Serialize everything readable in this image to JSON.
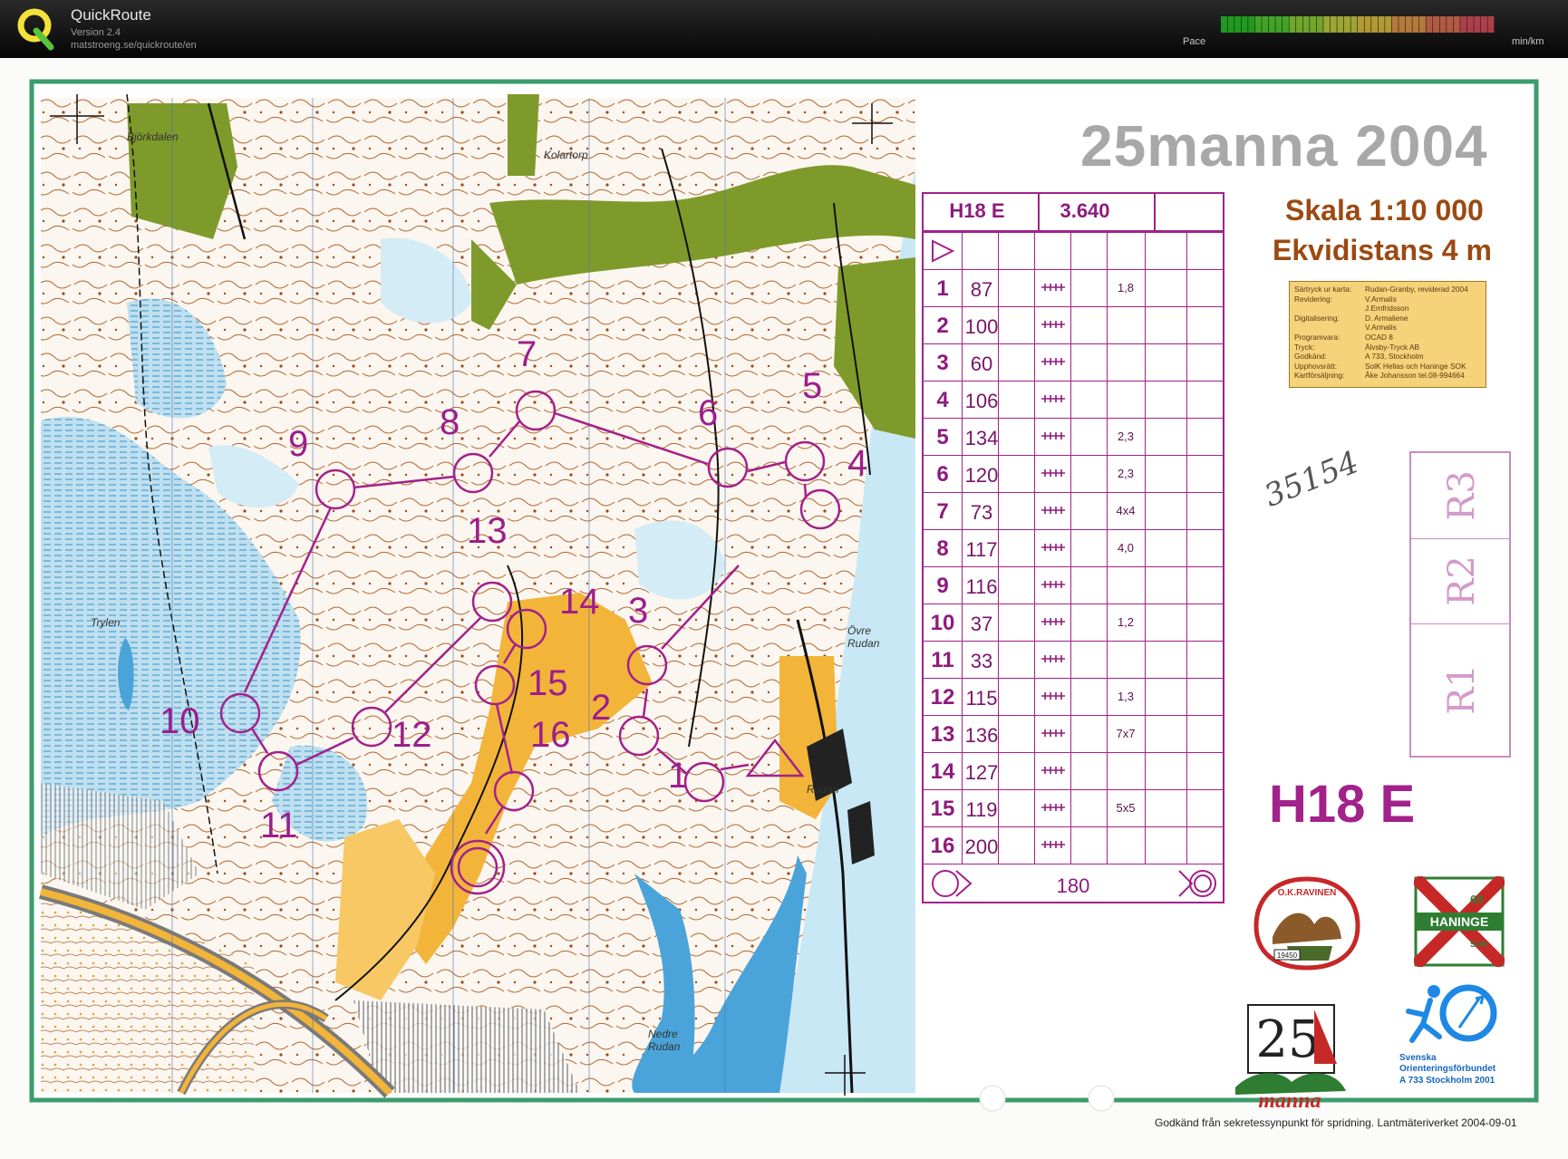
{
  "app": {
    "title": "QuickRoute",
    "version": "Version 2.4",
    "url": "matstroeng.se/quickroute/en"
  },
  "pace": {
    "label": "Pace",
    "unit": "min/km",
    "colors": [
      "#22c522",
      "#4fd12a",
      "#8ed630",
      "#c8d63a",
      "#e6c43c",
      "#e89a44",
      "#e3704c",
      "#dd4c5a"
    ]
  },
  "map": {
    "event_title": "25manna 2004",
    "scale": "Skala 1:10 000",
    "contour_interval": "Ekvidistans 4 m",
    "class_name": "H18 E",
    "handwritten_note": "35154",
    "footer_note": "Godkänd från sekretessynpunkt för spridning. Lantmäteriverket 2004-09-01",
    "place_names": [
      "Björkdalen",
      "Kolartorp",
      "Trylen",
      "Övre Rudan",
      "Rudan",
      "Nedre Rudan"
    ],
    "start_control_codes": [
      "R3",
      "R2",
      "R1"
    ],
    "credits": [
      {
        "k": "Särtryck ur karta:",
        "v": "Rudan-Granby, reviderad 2004"
      },
      {
        "k": "Revidering:",
        "v": "V.Armalis"
      },
      {
        "k": "",
        "v": "J.Ernfridsson"
      },
      {
        "k": "Digitalisering:",
        "v": "D. Armaliene"
      },
      {
        "k": "",
        "v": "V.Armalis"
      },
      {
        "k": "Programvara:",
        "v": "OCAD 8"
      },
      {
        "k": "Tryck:",
        "v": "Älvsby-Tryck AB"
      },
      {
        "k": "Godkänd:",
        "v": "A 733, Stockholm"
      },
      {
        "k": "Upphovsrätt:",
        "v": "SolK Hellas och Haninge SOK"
      },
      {
        "k": "Kartförsäljning:",
        "v": "Åke Johansson tel.08-994664"
      }
    ],
    "logos": {
      "ravinen_text": "O.K.RAVINEN",
      "ravinen_number": "19450",
      "haninge_text": "HANINGE",
      "haninge_top": "69",
      "haninge_sok": "SOK",
      "manna_number": "25",
      "manna_word": "manna",
      "sof_line1": "Svenska",
      "sof_line2": "Orienteringsförbundet",
      "sof_line3": "A 733 Stockholm 2001"
    },
    "control_numbers_on_map": [
      "1",
      "2",
      "3",
      "4",
      "5",
      "6",
      "7",
      "8",
      "9",
      "10",
      "11",
      "12",
      "13",
      "14",
      "15",
      "16"
    ]
  },
  "description": {
    "class": "H18 E",
    "length": "3.640",
    "finish_distance": "180",
    "controls": [
      {
        "n": "1",
        "code": "87",
        "extra": "1,8"
      },
      {
        "n": "2",
        "code": "100",
        "extra": ""
      },
      {
        "n": "3",
        "code": "60",
        "extra": ""
      },
      {
        "n": "4",
        "code": "106",
        "extra": ""
      },
      {
        "n": "5",
        "code": "134",
        "extra": "2,3"
      },
      {
        "n": "6",
        "code": "120",
        "extra": "2,3"
      },
      {
        "n": "7",
        "code": "73",
        "extra": "4x4"
      },
      {
        "n": "8",
        "code": "117",
        "extra": "4,0"
      },
      {
        "n": "9",
        "code": "116",
        "extra": ""
      },
      {
        "n": "10",
        "code": "37",
        "extra": "1,2"
      },
      {
        "n": "11",
        "code": "33",
        "extra": ""
      },
      {
        "n": "12",
        "code": "115",
        "extra": "1,3"
      },
      {
        "n": "13",
        "code": "136",
        "extra": "7x7"
      },
      {
        "n": "14",
        "code": "127",
        "extra": ""
      },
      {
        "n": "15",
        "code": "119",
        "extra": "5x5"
      },
      {
        "n": "16",
        "code": "200",
        "extra": ""
      }
    ]
  }
}
